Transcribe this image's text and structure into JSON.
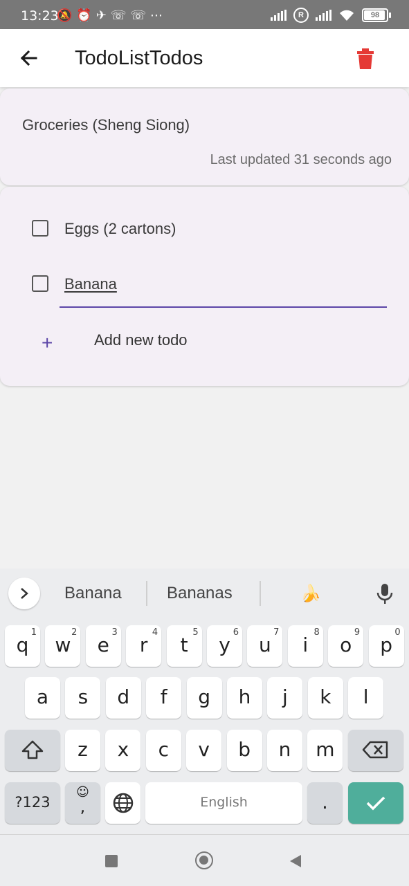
{
  "status_bar": {
    "time": "13:23",
    "icons": [
      "muted-bell-icon",
      "alarm-icon",
      "telegram-icon",
      "whatsapp-icon",
      "whatsapp-icon",
      "more-icon"
    ],
    "battery": "98"
  },
  "app_bar": {
    "title": "TodoListTodos"
  },
  "list_card": {
    "name": "Groceries (Sheng Siong)",
    "updated": "Last updated 31 seconds ago"
  },
  "todos": [
    {
      "text": "Eggs (2 cartons)",
      "checked": false
    },
    {
      "text": "Banana",
      "checked": false,
      "editing": true
    }
  ],
  "add_todo_label": "Add new todo",
  "keyboard": {
    "suggestions": [
      "Banana",
      "Bananas",
      "🍌"
    ],
    "row1": [
      {
        "k": "q",
        "n": "1"
      },
      {
        "k": "w",
        "n": "2"
      },
      {
        "k": "e",
        "n": "3"
      },
      {
        "k": "r",
        "n": "4"
      },
      {
        "k": "t",
        "n": "5"
      },
      {
        "k": "y",
        "n": "6"
      },
      {
        "k": "u",
        "n": "7"
      },
      {
        "k": "i",
        "n": "8"
      },
      {
        "k": "o",
        "n": "9"
      },
      {
        "k": "p",
        "n": "0"
      }
    ],
    "row2": [
      "a",
      "s",
      "d",
      "f",
      "g",
      "h",
      "j",
      "k",
      "l"
    ],
    "row3": [
      "z",
      "x",
      "c",
      "v",
      "b",
      "n",
      "m"
    ],
    "symbols_label": "?123",
    "comma_label": ",",
    "space_label": "English",
    "period_label": "."
  },
  "colors": {
    "accent": "#5b45a7",
    "trash": "#e53935",
    "enter_key": "#4fae9b"
  }
}
